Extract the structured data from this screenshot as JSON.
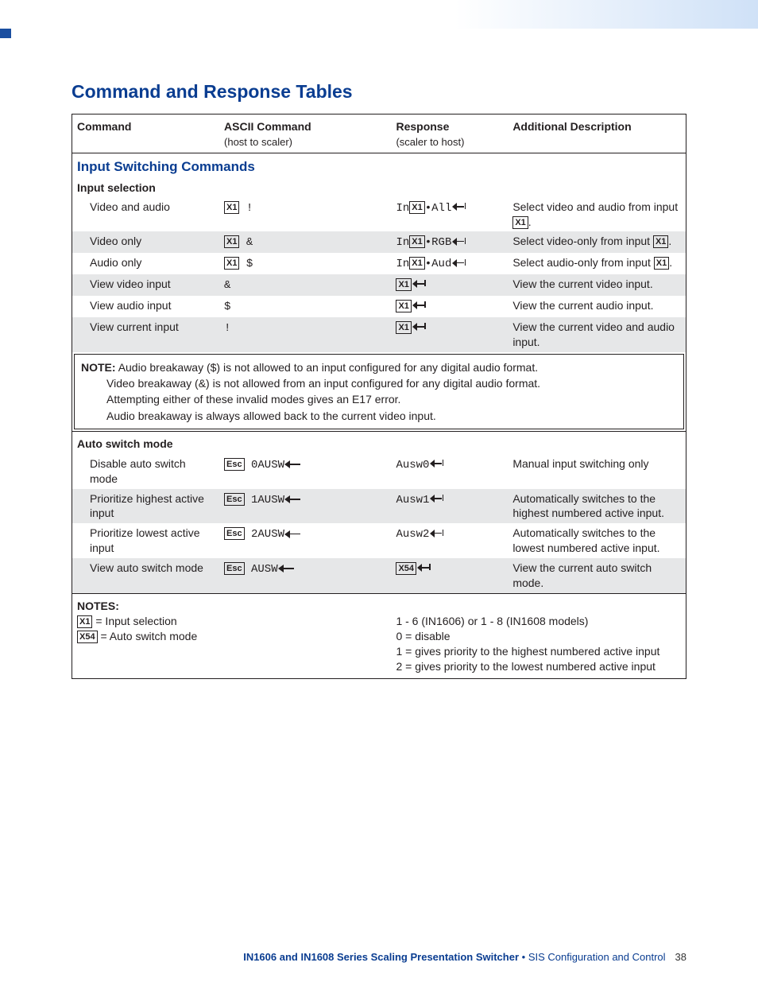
{
  "title": "Command and Response Tables",
  "header": {
    "c1": "Command",
    "c2": "ASCII Command",
    "c2sub": "(host to scaler)",
    "c3": "Response",
    "c3sub": "(scaler to host)",
    "c4": "Additional Description"
  },
  "section1": "Input Switching Commands",
  "subsection1": "Input selection",
  "rows_input": [
    {
      "cmd": "Video and audio",
      "asc_pre": "",
      "asc_box": "X1",
      "asc_post": " !",
      "rsp_pre": "In",
      "rsp_box": "X1",
      "rsp_mid": "•All",
      "ret": true,
      "desc_pre": "Select video and audio from input ",
      "desc_box": "X1",
      "desc_post": "."
    },
    {
      "cmd": "Video only",
      "asc_pre": "",
      "asc_box": "X1",
      "asc_post": " &",
      "rsp_pre": "In",
      "rsp_box": "X1",
      "rsp_mid": "•RGB",
      "ret": true,
      "desc_pre": "Select video-only from input ",
      "desc_box": "X1",
      "desc_post": "."
    },
    {
      "cmd": "Audio only",
      "asc_pre": "",
      "asc_box": "X1",
      "asc_post": " $",
      "rsp_pre": "In",
      "rsp_box": "X1",
      "rsp_mid": "•Aud",
      "ret": true,
      "desc_pre": "Select audio-only from input ",
      "desc_box": "X1",
      "desc_post": "."
    },
    {
      "cmd": "View video input",
      "asc_pre": "&",
      "asc_box": "",
      "asc_post": "",
      "rsp_pre": "",
      "rsp_box": "X1",
      "rsp_mid": "",
      "ret": true,
      "desc_pre": "View the current video input.",
      "desc_box": "",
      "desc_post": ""
    },
    {
      "cmd": "View audio input",
      "asc_pre": "$",
      "asc_box": "",
      "asc_post": "",
      "rsp_pre": "",
      "rsp_box": "X1",
      "rsp_mid": "",
      "ret": true,
      "desc_pre": "View the current audio input.",
      "desc_box": "",
      "desc_post": ""
    },
    {
      "cmd": "View current input",
      "asc_pre": "!",
      "asc_box": "",
      "asc_post": "",
      "rsp_pre": "",
      "rsp_box": "X1",
      "rsp_mid": "",
      "ret": true,
      "desc_pre": "View the current video and audio input.",
      "desc_box": "",
      "desc_post": ""
    }
  ],
  "note1": {
    "label": "NOTE:",
    "l1": "Audio breakaway ($) is not allowed to an input configured for any digital audio format.",
    "l2": "Video breakaway (&) is not allowed from an input configured for any digital audio format.",
    "l3": "Attempting either of these invalid modes gives an E17 error.",
    "l4": "Audio breakaway is always allowed back to the current video input."
  },
  "subsection2": "Auto switch mode",
  "rows_auto": [
    {
      "cmd": "Disable auto switch mode",
      "esc": "Esc",
      "asc": "0AUSW",
      "arrow": true,
      "rsp": "Ausw0",
      "ret": true,
      "desc": "Manual input switching only"
    },
    {
      "cmd": "Prioritize highest active input",
      "esc": "Esc",
      "asc": "1AUSW",
      "arrow": true,
      "rsp": "Ausw1",
      "ret": true,
      "desc": "Automatically switches to the highest numbered active input."
    },
    {
      "cmd": "Prioritize lowest active input",
      "esc": "Esc",
      "asc": "2AUSW",
      "arrow": true,
      "rsp": "Ausw2",
      "ret": true,
      "desc": "Automatically switches to the lowest numbered active input."
    },
    {
      "cmd": "View auto switch mode",
      "esc": "Esc",
      "asc": "AUSW",
      "arrow": true,
      "rsp_box": "X54",
      "ret": true,
      "desc": "View the current auto switch mode."
    }
  ],
  "notes2": {
    "label": "NOTES:",
    "left": [
      {
        "box": "X1",
        "txt": " = Input selection"
      },
      {
        "box": "X54",
        "txt": " = Auto switch mode"
      }
    ],
    "right": [
      "1 - 6 (IN1606) or 1 - 8 (IN1608 models)",
      "0 = disable",
      "1 = gives priority to the highest numbered active input",
      "2 = gives priority to the lowest numbered active input"
    ]
  },
  "footer": {
    "title": "IN1606 and IN1608 Series Scaling Presentation Switcher",
    "sep": " • ",
    "section": "SIS Configuration and Control",
    "page": "38"
  }
}
